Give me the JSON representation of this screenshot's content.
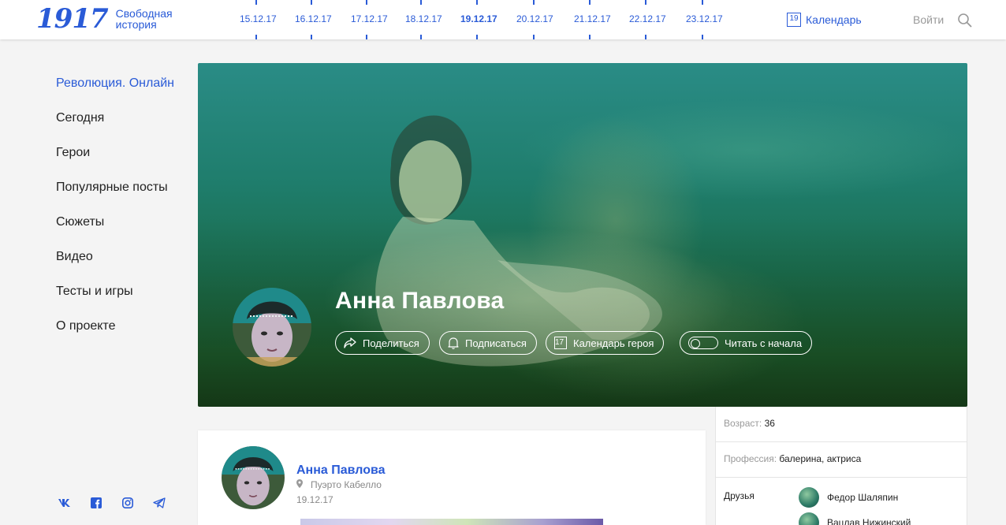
{
  "header": {
    "logo_number": "1917",
    "logo_line1": "Свободная",
    "logo_line2": "история",
    "dates": [
      "15.12.17",
      "16.12.17",
      "17.12.17",
      "18.12.17",
      "19.12.17",
      "20.12.17",
      "21.12.17",
      "22.12.17",
      "23.12.17"
    ],
    "active_date": "19.12.17",
    "calendar_day": "19",
    "calendar_label": "Календарь",
    "login_label": "Войти"
  },
  "sidebar": {
    "items": [
      {
        "label": "Революция. Онлайн",
        "active": true
      },
      {
        "label": "Сегодня"
      },
      {
        "label": "Герои"
      },
      {
        "label": "Популярные посты"
      },
      {
        "label": "Сюжеты"
      },
      {
        "label": "Видео"
      },
      {
        "label": "Тесты и игры"
      },
      {
        "label": "О проекте"
      }
    ],
    "socials": [
      "vk-icon",
      "facebook-icon",
      "instagram-icon",
      "telegram-icon"
    ]
  },
  "hero": {
    "name": "Анна Павлова",
    "buttons": {
      "share": "Поделиться",
      "subscribe": "Подписаться",
      "calendar_day": "17",
      "calendar": "Календарь героя",
      "read": "Читать с начала"
    }
  },
  "info": {
    "age_label": "Возраст:",
    "age_value": "36",
    "profession_label": "Профессия:",
    "profession_value": "балерина, актриса",
    "friends_label": "Друзья",
    "friends": [
      "Федор Шаляпин",
      "Вацлав Нижинский"
    ]
  },
  "post": {
    "author": "Анна Павлова",
    "location": "Пуэрто Кабелло",
    "date": "19.12.17"
  },
  "colors": {
    "accent": "#2a5bd7",
    "background": "#f4f4f4",
    "hero_top": "#2a8c86",
    "hero_bottom": "#1c4a1e"
  }
}
